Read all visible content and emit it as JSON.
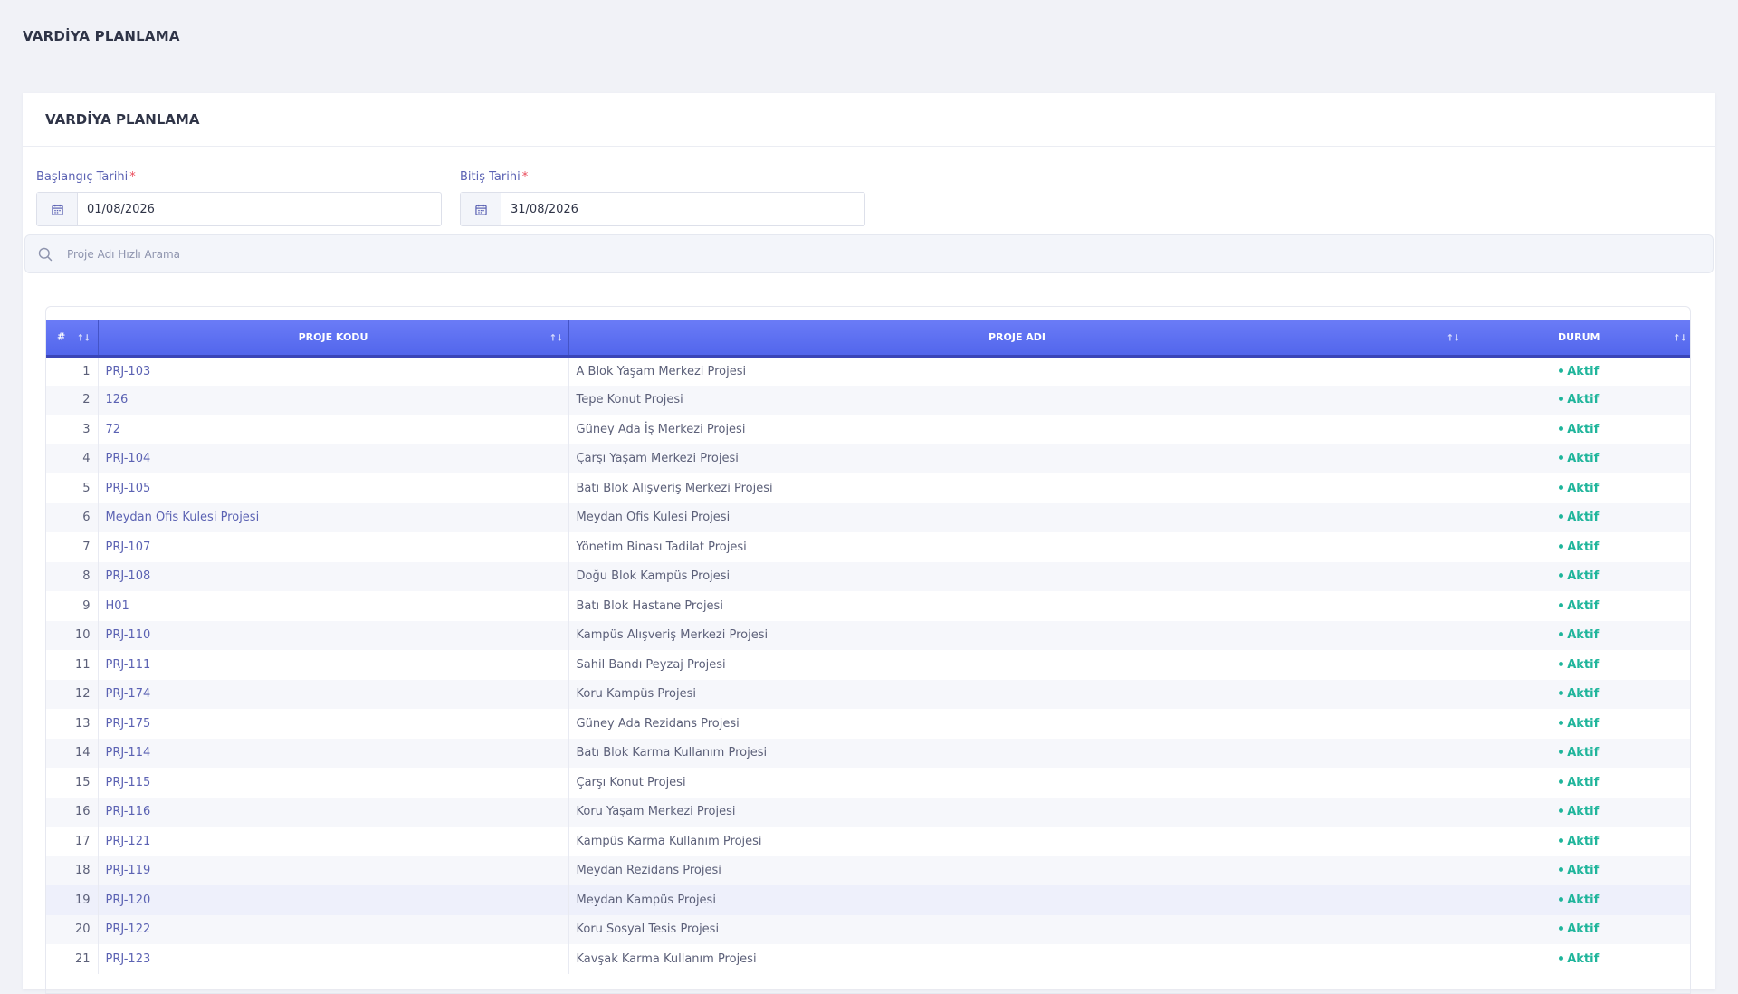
{
  "page": {
    "title": "VARDİYA PLANLAMA"
  },
  "card": {
    "title": "VARDİYA PLANLAMA"
  },
  "filters": {
    "start_label": "Başlangıç Tarihi",
    "start_value": "01/08/2026",
    "end_label": "Bitiş Tarihi",
    "end_value": "31/08/2026",
    "required_mark": "*",
    "calendar_icon": "calendar-icon"
  },
  "search": {
    "placeholder": "Proje Adı Hızlı Arama",
    "icon": "search-icon"
  },
  "table": {
    "columns": {
      "no": "#",
      "code": "PROJE KODU",
      "name": "PROJE ADI",
      "status": "DURUM"
    },
    "sort_glyph": "↑↓",
    "rows": [
      {
        "no": "1",
        "code": "PRJ-103",
        "name": "A Blok Yaşam Merkezi Projesi",
        "status": "Aktif"
      },
      {
        "no": "2",
        "code": "126",
        "name": "Tepe Konut Projesi",
        "status": "Aktif"
      },
      {
        "no": "3",
        "code": "72",
        "name": "Güney Ada İş Merkezi Projesi",
        "status": "Aktif"
      },
      {
        "no": "4",
        "code": "PRJ-104",
        "name": "Çarşı Yaşam Merkezi Projesi",
        "status": "Aktif"
      },
      {
        "no": "5",
        "code": "PRJ-105",
        "name": "Batı Blok Alışveriş Merkezi Projesi",
        "status": "Aktif"
      },
      {
        "no": "6",
        "code": "Meydan Ofis Kulesi Projesi",
        "name": "Meydan Ofis Kulesi Projesi",
        "status": "Aktif"
      },
      {
        "no": "7",
        "code": "PRJ-107",
        "name": "Yönetim Binası Tadilat Projesi",
        "status": "Aktif"
      },
      {
        "no": "8",
        "code": "PRJ-108",
        "name": "Doğu Blok Kampüs Projesi",
        "status": "Aktif"
      },
      {
        "no": "9",
        "code": "H01",
        "name": "Batı Blok Hastane Projesi",
        "status": "Aktif"
      },
      {
        "no": "10",
        "code": "PRJ-110",
        "name": "Kampüs Alışveriş Merkezi Projesi",
        "status": "Aktif"
      },
      {
        "no": "11",
        "code": "PRJ-111",
        "name": "Sahil Bandı Peyzaj Projesi",
        "status": "Aktif"
      },
      {
        "no": "12",
        "code": "PRJ-174",
        "name": "Koru Kampüs Projesi",
        "status": "Aktif"
      },
      {
        "no": "13",
        "code": "PRJ-175",
        "name": "Güney Ada Rezidans Projesi",
        "status": "Aktif"
      },
      {
        "no": "14",
        "code": "PRJ-114",
        "name": "Batı Blok Karma Kullanım Projesi",
        "status": "Aktif"
      },
      {
        "no": "15",
        "code": "PRJ-115",
        "name": "Çarşı Konut Projesi",
        "status": "Aktif"
      },
      {
        "no": "16",
        "code": "PRJ-116",
        "name": "Koru Yaşam Merkezi Projesi",
        "status": "Aktif"
      },
      {
        "no": "17",
        "code": "PRJ-121",
        "name": "Kampüs Karma Kullanım Projesi",
        "status": "Aktif"
      },
      {
        "no": "18",
        "code": "PRJ-119",
        "name": "Meydan Rezidans Projesi",
        "status": "Aktif"
      },
      {
        "no": "19",
        "code": "PRJ-120",
        "name": "Meydan Kampüs Projesi",
        "status": "Aktif"
      },
      {
        "no": "20",
        "code": "PRJ-122",
        "name": "Koru Sosyal Tesis Projesi",
        "status": "Aktif"
      },
      {
        "no": "21",
        "code": "PRJ-123",
        "name": "Kavşak Karma Kullanım Projesi",
        "status": "Aktif"
      }
    ],
    "highlighted_row": 19
  },
  "colors": {
    "header_gradient_top": "#6b7cf7",
    "header_gradient_bottom": "#5266ec",
    "link": "#5b62b3",
    "status_active": "#1fb59b",
    "required": "#ea4b5a"
  }
}
